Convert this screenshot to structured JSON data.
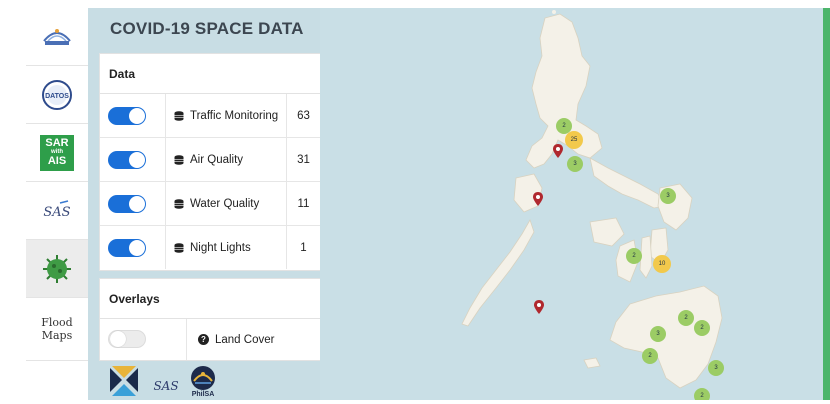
{
  "app": {
    "title": "COVID-19 SPACE DATA"
  },
  "sidebar": {
    "items": [
      {
        "name": "philsa-logo-icon",
        "label": "PHILSA"
      },
      {
        "name": "datos-logo-icon",
        "label": "DATOS"
      },
      {
        "name": "sar-ais-icon",
        "label_top": "SAR",
        "label_mid": "with",
        "label_bot": "AIS"
      },
      {
        "name": "sas-logo-icon",
        "label": "SAS"
      },
      {
        "name": "virus-icon",
        "label": ""
      },
      {
        "name": "flood-maps",
        "label_line1": "Flood",
        "label_line2": "Maps"
      }
    ]
  },
  "data_card": {
    "heading": "Data",
    "rows": [
      {
        "label": "Traffic Monitoring",
        "count": "63",
        "enabled": true,
        "icon": "database-icon"
      },
      {
        "label": "Air Quality",
        "count": "31",
        "enabled": true,
        "icon": "database-icon"
      },
      {
        "label": "Water Quality",
        "count": "11",
        "enabled": true,
        "icon": "database-icon"
      },
      {
        "label": "Night Lights",
        "count": "1",
        "enabled": true,
        "icon": "database-icon"
      }
    ]
  },
  "overlays_card": {
    "heading": "Overlays",
    "rows": [
      {
        "label": "Land Cover",
        "enabled": false,
        "icon": "question-circle-icon"
      }
    ]
  },
  "footer_logos": {
    "philsa_label": "PhilSA",
    "sas_label": "SAS"
  },
  "map": {
    "markers": [
      {
        "type": "cluster",
        "color": "#9ccc65",
        "label": "2"
      },
      {
        "type": "cluster",
        "color": "#f2c94c",
        "label": "25"
      },
      {
        "type": "cluster",
        "color": "#9ccc65",
        "label": "3"
      },
      {
        "type": "cluster",
        "color": "#9ccc65",
        "label": "3"
      },
      {
        "type": "cluster",
        "color": "#9ccc65",
        "label": "2"
      },
      {
        "type": "cluster",
        "color": "#f2c94c",
        "label": "10"
      },
      {
        "type": "cluster",
        "color": "#9ccc65",
        "label": "2"
      },
      {
        "type": "cluster",
        "color": "#9ccc65",
        "label": "3"
      },
      {
        "type": "cluster",
        "color": "#9ccc65",
        "label": "2"
      },
      {
        "type": "cluster",
        "color": "#9ccc65",
        "label": "2"
      },
      {
        "type": "cluster",
        "color": "#9ccc65",
        "label": "3"
      },
      {
        "type": "cluster",
        "color": "#9ccc65",
        "label": "2"
      }
    ],
    "pin_color": "#b0282e",
    "land_color": "#f4f1e8",
    "water_color": "#c9dfe6"
  },
  "colors": {
    "toggle_on": "#1a6fd8",
    "accent_green": "#4cb56b",
    "panel_bg": "#c8dde4"
  }
}
